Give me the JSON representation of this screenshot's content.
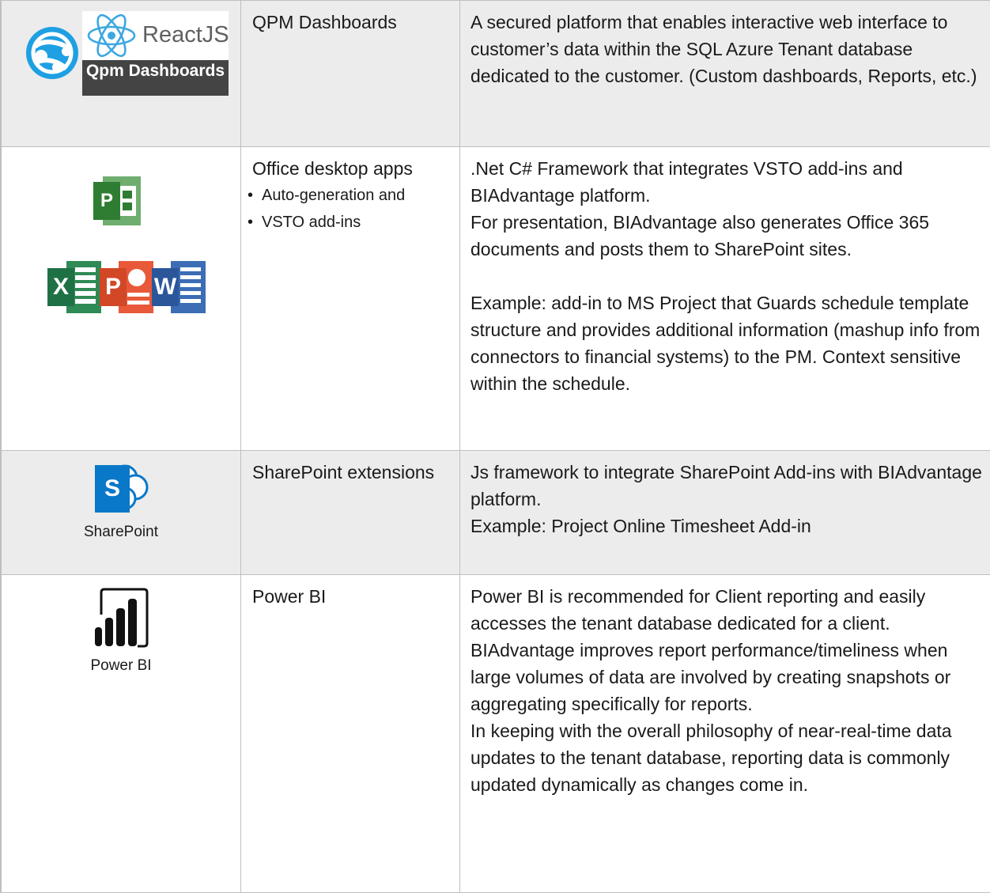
{
  "rows": [
    {
      "label": "QPM Dashboards",
      "logo": {
        "react_text": "ReactJS",
        "subtitle": "Qpm Dashboards",
        "icons": [
          "azure-app-service-icon",
          "react-atom-icon"
        ]
      },
      "description": [
        "A secured platform that enables interactive web interface to customer’s data within the SQL Azure Tenant database dedicated to the customer. (Custom dashboards, Reports, etc.)"
      ]
    },
    {
      "label": "Office desktop apps",
      "bullets": [
        "Auto-generation and",
        "VSTO add-ins"
      ],
      "logo": {
        "project_letter": "P",
        "excel_letter": "X",
        "powerpoint_letter": "P",
        "word_letter": "W",
        "icons": [
          "ms-project-icon",
          "excel-icon",
          "powerpoint-icon",
          "word-icon"
        ]
      },
      "description": [
        ".Net C# Framework that integrates VSTO add-ins and BIAdvantage platform.",
        "For presentation, BIAdvantage also generates Office 365 documents and posts them to SharePoint sites.",
        "",
        "Example: add-in to MS Project that Guards schedule template structure and provides additional information (mashup info from connectors to financial systems) to the PM. Context sensitive within the schedule."
      ]
    },
    {
      "label": "SharePoint extensions",
      "logo": {
        "letter": "S",
        "caption": "SharePoint",
        "icons": [
          "sharepoint-icon"
        ]
      },
      "description": [
        "Js framework to integrate SharePoint Add-ins with BIAdvantage platform.",
        "Example: Project Online Timesheet Add-in"
      ]
    },
    {
      "label": "Power BI",
      "logo": {
        "caption": "Power BI",
        "icons": [
          "power-bi-icon"
        ]
      },
      "description": [
        "Power BI is recommended for Client reporting and easily accesses the tenant database dedicated for a client.",
        "BIAdvantage improves report performance/timeliness when large volumes of data are involved by creating snapshots or aggregating specifically for reports.",
        "In keeping with the overall philosophy of near-real-time data updates to the tenant database, reporting data is commonly updated dynamically as changes come in."
      ]
    }
  ],
  "colors": {
    "azure_blue": "#1ea0e2",
    "react_blue": "#3da7e0",
    "project_green": "#2e7d32",
    "excel_green": "#1e7145",
    "powerpoint_orange": "#d24726",
    "word_blue": "#2b579a",
    "sharepoint_blue": "#0a78c8",
    "shaded_row": "#ececec",
    "border": "#bfbfbf"
  }
}
